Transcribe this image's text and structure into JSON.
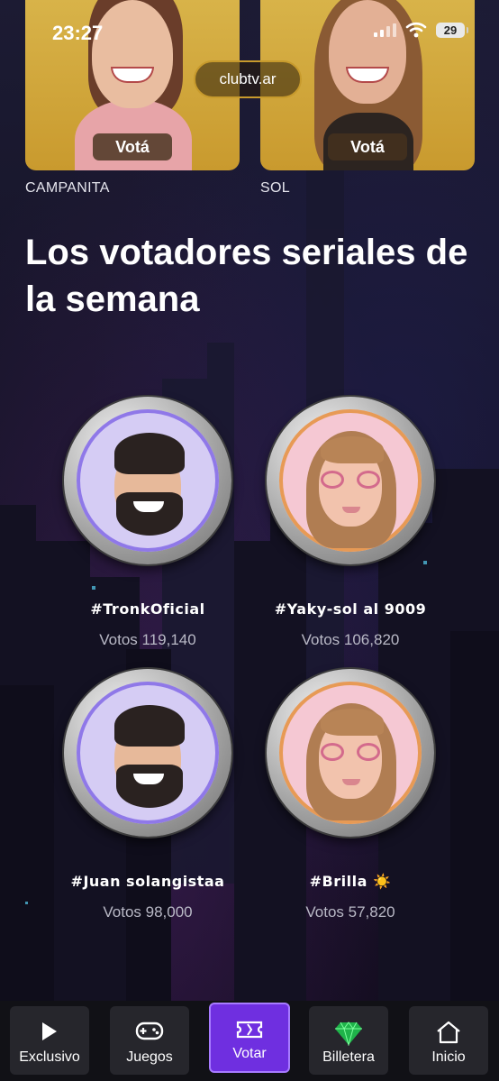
{
  "status_bar": {
    "time": "23:27",
    "battery": "29"
  },
  "url_pill": "clubtv.ar",
  "candidates": [
    {
      "name": "CAMPANITA",
      "vote_label": "Votá"
    },
    {
      "name": "SOL",
      "vote_label": "Votá"
    }
  ],
  "section_title": "Los votadores seriales de la semana",
  "voters": [
    {
      "name": "#TronkOficial",
      "votes": "Votos 119,140",
      "avatar": "male-memoji"
    },
    {
      "name": "#Yaky-sol al 9009",
      "votes": "Votos 106,820",
      "avatar": "female-memoji"
    },
    {
      "name": "#Juan solangistaa",
      "votes": "Votos 98,000",
      "avatar": "male-memoji"
    },
    {
      "name": "#Brilla ☀️",
      "votes": "Votos 57,820",
      "avatar": "female-memoji"
    }
  ],
  "nav": [
    {
      "label": "Exclusivo",
      "icon": "play-icon"
    },
    {
      "label": "Juegos",
      "icon": "gamepad-icon"
    },
    {
      "label": "Votar",
      "icon": "ticket-icon",
      "active": true
    },
    {
      "label": "Billetera",
      "icon": "gem-icon"
    },
    {
      "label": "Inicio",
      "icon": "home-icon"
    }
  ],
  "colors": {
    "accent": "#6f2fe0",
    "gold": "#c99a2e",
    "nav_bg": "#111116"
  }
}
